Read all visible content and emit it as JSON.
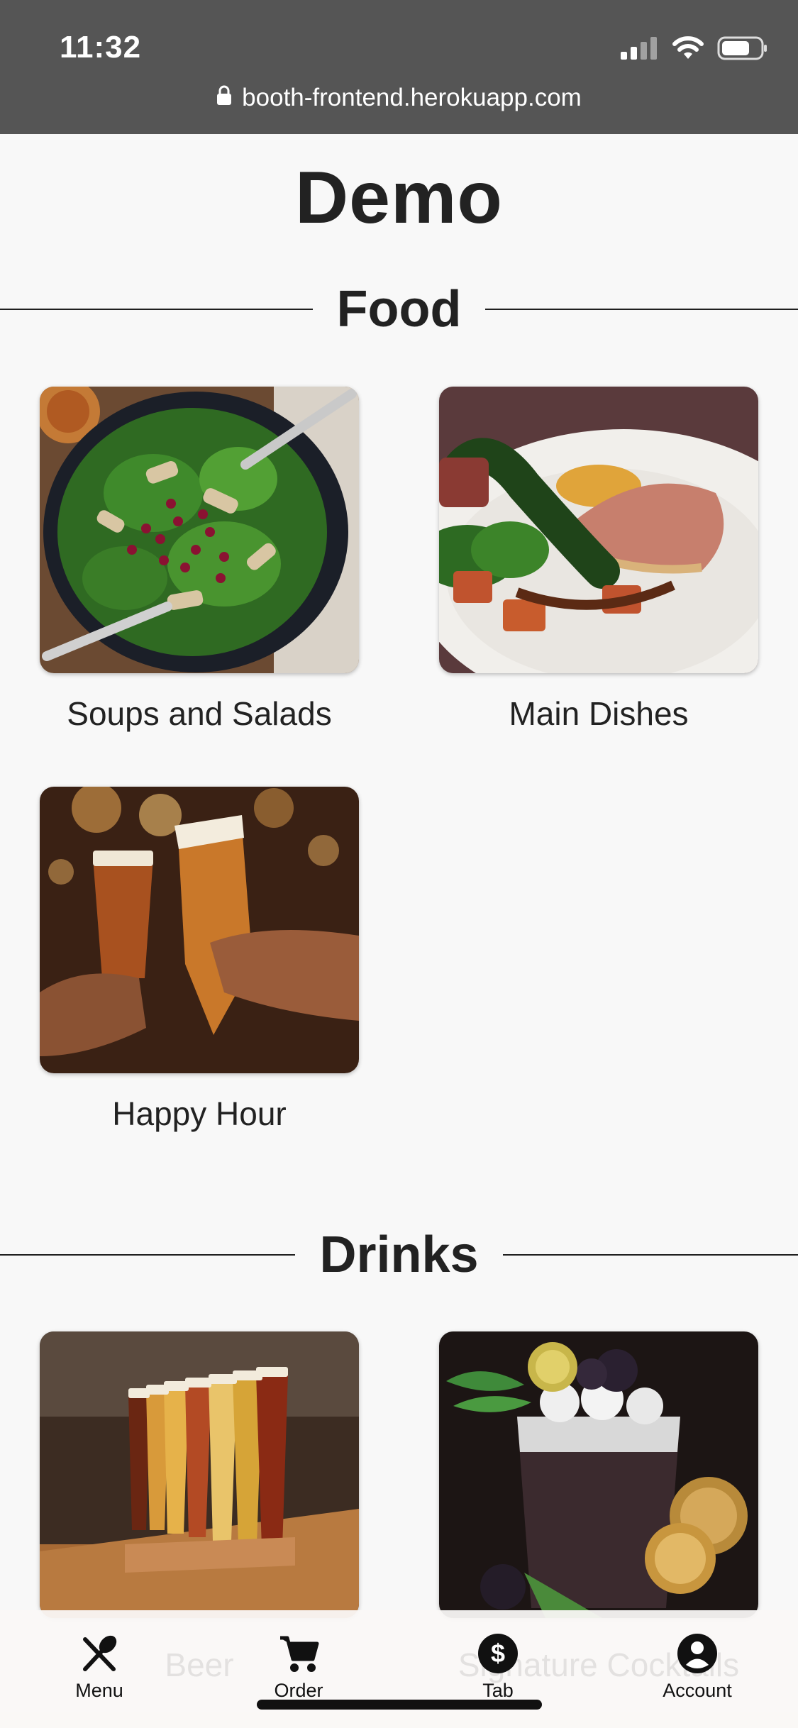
{
  "status_bar": {
    "time": "11:32",
    "url": "booth-frontend.herokuapp.com"
  },
  "app_title": "Demo",
  "sections": {
    "food": {
      "heading": "Food",
      "items": [
        {
          "label": "Soups and Salads"
        },
        {
          "label": "Main Dishes"
        },
        {
          "label": "Happy Hour"
        }
      ]
    },
    "drinks": {
      "heading": "Drinks",
      "items": [
        {
          "label": "Beer"
        },
        {
          "label": "Signature Cocktails"
        }
      ]
    }
  },
  "bottom_nav": {
    "items": [
      {
        "label": "Menu",
        "icon": "fork-spoon-icon"
      },
      {
        "label": "Order",
        "icon": "cart-icon"
      },
      {
        "label": "Tab",
        "icon": "dollar-circle-icon"
      },
      {
        "label": "Account",
        "icon": "account-circle-icon"
      }
    ]
  },
  "colors": {
    "status_bar_bg": "#555555",
    "page_bg": "#f8f8f8",
    "text": "#1f1f1f"
  }
}
